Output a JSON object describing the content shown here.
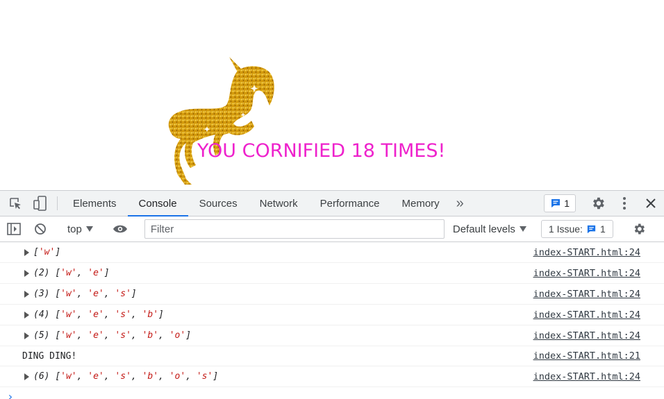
{
  "page": {
    "cornified_text": "YOU CORNIFIED 18 TIMES!"
  },
  "devtools": {
    "tabs": [
      {
        "label": "Elements",
        "active": false
      },
      {
        "label": "Console",
        "active": true
      },
      {
        "label": "Sources",
        "active": false
      },
      {
        "label": "Network",
        "active": false
      },
      {
        "label": "Performance",
        "active": false
      },
      {
        "label": "Memory",
        "active": false
      }
    ],
    "messages_badge_count": "1",
    "context_label": "top",
    "filter_placeholder": "Filter",
    "levels_label": "Default levels",
    "issues_label": "1 Issue:",
    "issues_count": "1"
  },
  "console_rows": [
    {
      "count": "",
      "items": [
        "w"
      ],
      "source": "index-START.html:24"
    },
    {
      "count": "(2)",
      "items": [
        "w",
        "e"
      ],
      "source": "index-START.html:24"
    },
    {
      "count": "(3)",
      "items": [
        "w",
        "e",
        "s"
      ],
      "source": "index-START.html:24"
    },
    {
      "count": "(4)",
      "items": [
        "w",
        "e",
        "s",
        "b"
      ],
      "source": "index-START.html:24"
    },
    {
      "count": "(5)",
      "items": [
        "w",
        "e",
        "s",
        "b",
        "o"
      ],
      "source": "index-START.html:24"
    },
    {
      "text": "DING DING!",
      "source": "index-START.html:21"
    },
    {
      "count": "(6)",
      "items": [
        "w",
        "e",
        "s",
        "b",
        "o",
        "s"
      ],
      "source": "index-START.html:24"
    }
  ],
  "prompt_symbol": "›",
  "colors": {
    "cornified": "#ee22cc",
    "accent": "#1a73e8",
    "string_value": "#c41a16",
    "unicorn_gold": "#d9a410"
  },
  "icons": [
    "inspect-icon",
    "device-toggle-icon",
    "more-tabs-icon",
    "message-icon",
    "gear-icon",
    "kebab-icon",
    "close-icon",
    "sidebar-icon",
    "clear-icon",
    "dropdown-icon",
    "eye-icon"
  ]
}
